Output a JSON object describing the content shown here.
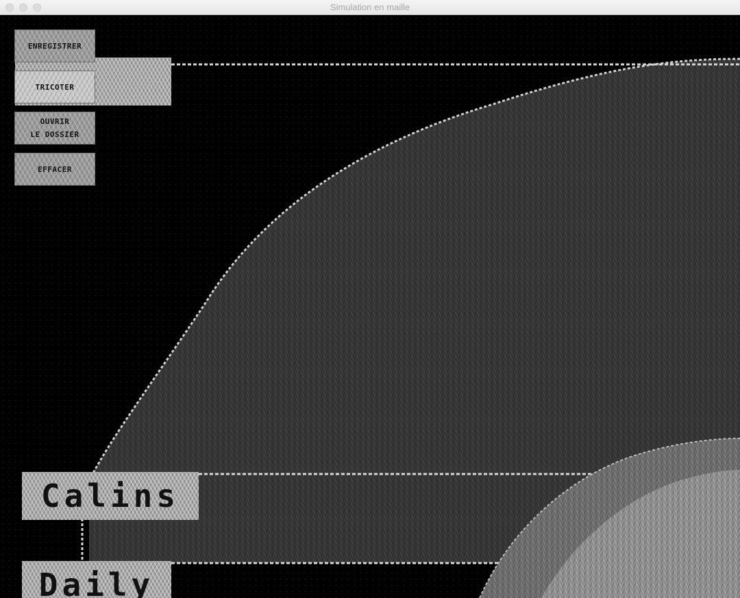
{
  "window": {
    "title": "Simulation en maille"
  },
  "buttons": {
    "save": "ENREGISTRER",
    "knit": "TRiCOTER",
    "open_folder": "OUVRiR\nLE DOSSiER",
    "clear": "EFFACER"
  },
  "canvas": {
    "labels": {
      "middle": "Calins",
      "bottom": "Daily"
    }
  },
  "colors": {
    "background": "#000000",
    "knit_dark": "#3a3a3a",
    "knit_light": "#9a9a9a",
    "stitch_highlight": "#d9d9d9"
  }
}
